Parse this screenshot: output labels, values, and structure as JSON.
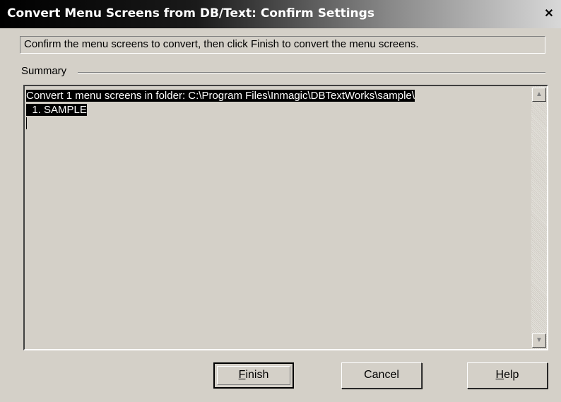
{
  "window": {
    "title": "Convert Menu Screens from DB/Text: Confirm Settings",
    "close_glyph": "✕"
  },
  "instruction": "Confirm the menu screens to convert, then click Finish to convert the menu screens.",
  "summary": {
    "label": "Summary",
    "lines": [
      "Convert 1 menu screens in folder: C:\\Program Files\\Inmagic\\DBTextWorks\\sample\\",
      "  1. SAMPLE"
    ]
  },
  "scrollbar": {
    "up_glyph": "▲",
    "down_glyph": "▼"
  },
  "buttons": {
    "finish": {
      "mnemonic": "F",
      "rest": "inish"
    },
    "cancel": {
      "label": "Cancel"
    },
    "help": {
      "mnemonic": "H",
      "rest": "elp"
    }
  }
}
